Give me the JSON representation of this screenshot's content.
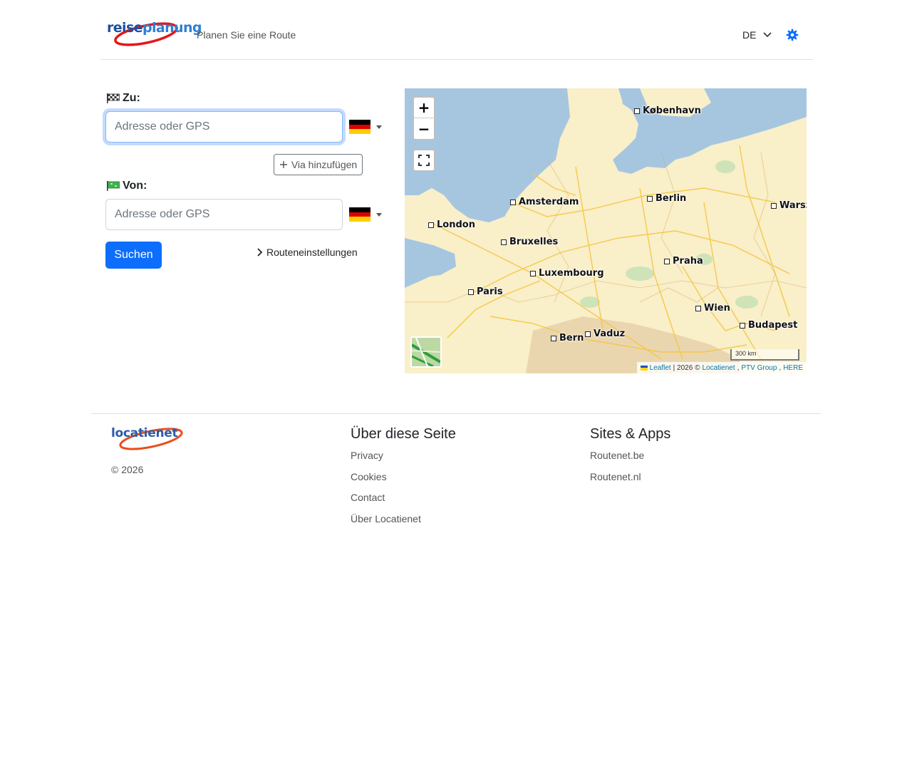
{
  "header": {
    "logo_part1": "reise",
    "logo_part2": "planung",
    "tagline": "Planen Sie eine Route",
    "language": "DE"
  },
  "form": {
    "to_label": "Zu:",
    "to_placeholder": "Adresse oder GPS",
    "to_value": "",
    "via_button": "Via hinzufügen",
    "from_label": "Von:",
    "from_placeholder": "Adresse oder GPS",
    "from_value": "",
    "country_flag": "germany-flag-icon",
    "search_button": "Suchen",
    "route_settings": "Routeneinstellungen"
  },
  "map": {
    "zoom_in": "+",
    "zoom_out": "−",
    "cities": [
      {
        "name": "København"
      },
      {
        "name": "Berlin"
      },
      {
        "name": "Amsterdam"
      },
      {
        "name": "Warsz"
      },
      {
        "name": "London"
      },
      {
        "name": "Bruxelles"
      },
      {
        "name": "Praha"
      },
      {
        "name": "Luxembourg"
      },
      {
        "name": "Paris"
      },
      {
        "name": "Wien"
      },
      {
        "name": "Budapest"
      },
      {
        "name": "Vaduz"
      },
      {
        "name": "Bern"
      }
    ],
    "scale": "300 km",
    "attribution": {
      "leaflet": "Leaflet",
      "year_text": "| 2026 ©",
      "locatienet": "Locatienet",
      "ptv": "PTV Group",
      "here": "HERE"
    },
    "colors": {
      "water": "#a6c6e0",
      "land": "#f9efc8",
      "roads": "#f5c542"
    }
  },
  "footer": {
    "logo": "locatienet",
    "copyright": "© 2026",
    "about_heading": "Über diese Seite",
    "about_links": [
      "Privacy",
      "Cookies",
      "Contact",
      "Über Locatienet"
    ],
    "sites_heading": "Sites & Apps",
    "sites_links": [
      "Routenet.be",
      "Routenet.nl"
    ]
  },
  "colors": {
    "primary": "#0d6efd",
    "border": "#dee2e6",
    "focus": "#86b7fe"
  }
}
